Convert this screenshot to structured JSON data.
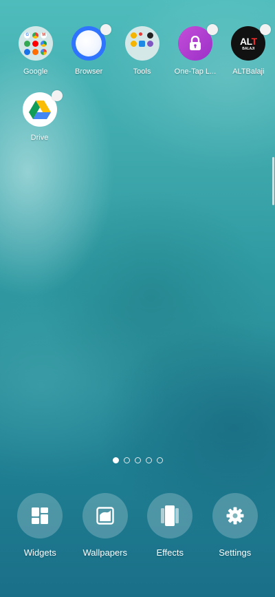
{
  "apps": [
    {
      "id": "google",
      "label": "Google",
      "type": "folder",
      "badge": false
    },
    {
      "id": "browser",
      "label": "Browser",
      "type": "browser",
      "badge": true
    },
    {
      "id": "tools",
      "label": "Tools",
      "type": "folder",
      "badge": false
    },
    {
      "id": "one-tap-lock",
      "label": "One-Tap L...",
      "type": "lock",
      "badge": true
    },
    {
      "id": "altbalaji",
      "label": "ALTBalaji",
      "type": "alt",
      "badge": true,
      "logo_text": "ALT",
      "logo_sub": "BALAJI"
    },
    {
      "id": "drive",
      "label": "Drive",
      "type": "drive",
      "badge": true
    }
  ],
  "page_indicator": {
    "total": 5,
    "active_index": 0
  },
  "actions": [
    {
      "id": "widgets",
      "label": "Widgets",
      "icon": "widgets-icon"
    },
    {
      "id": "wallpapers",
      "label": "Wallpapers",
      "icon": "wallpaper-icon"
    },
    {
      "id": "effects",
      "label": "Effects",
      "icon": "effects-icon"
    },
    {
      "id": "settings",
      "label": "Settings",
      "icon": "gear-icon"
    }
  ],
  "colors": {
    "browser_blue": "#2f74ff",
    "lock_purple": "#b040d0",
    "alt_red": "#ff2a2a",
    "label_white": "#ffffff"
  }
}
